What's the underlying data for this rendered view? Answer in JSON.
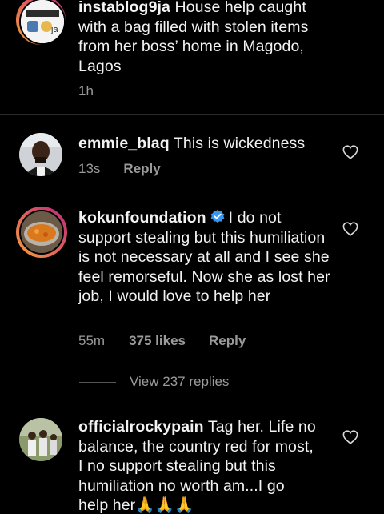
{
  "caption": {
    "username": "instablog9ja",
    "text": "House help caught with a bag filled with stolen items from her boss’ home in Magodo, Lagos",
    "time": "1h"
  },
  "comments": [
    {
      "username": "emmie_blaq",
      "text": "This is wickedness",
      "time": "13s",
      "reply_label": "Reply"
    },
    {
      "username": "kokunfoundation",
      "verified": true,
      "text": "I do not support stealing but this humiliation is not necessary at all and I see she feel remorseful. Now she as lost her job, I would love to help her",
      "time": "55m",
      "likes": "375 likes",
      "reply_label": "Reply",
      "view_replies": "View 237 replies"
    },
    {
      "username": "officialrockypain",
      "text": "Tag her. Life no balance, the country red for most, I no support stealing but this humiliation no worth am...I go help her🙏🙏🙏"
    }
  ],
  "icons": {
    "like": "heart-icon",
    "verified": "verified-badge-icon"
  },
  "colors": {
    "background": "#000000",
    "text": "#f2f2f2",
    "secondary": "#9a9a9a",
    "verified": "#3897f0",
    "story_ring_start": "#f9a13b",
    "story_ring_end": "#c0237a"
  }
}
